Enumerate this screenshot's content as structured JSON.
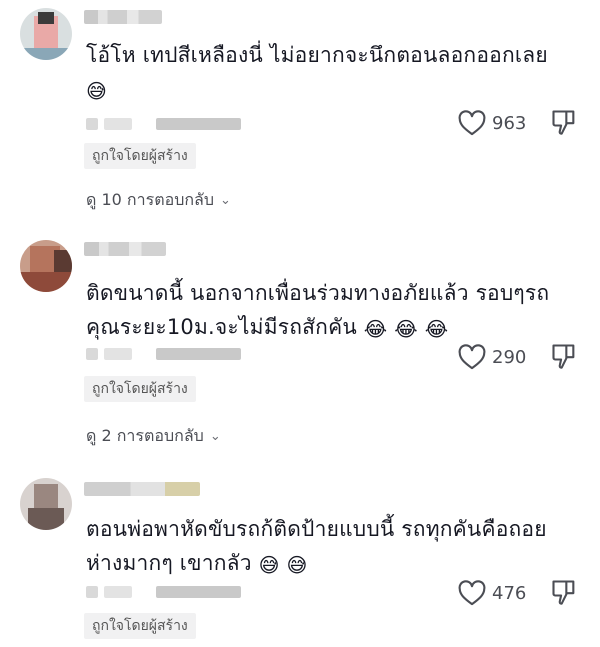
{
  "comments": [
    {
      "text": "โอ้โห เทปสีเหลืองนี่ ไม่อยากจะนึกตอนลอกออกเลย",
      "emojis": [
        "😅"
      ],
      "likes": "963",
      "creator_badge": "ถูกใจโดยผู้สร้าง",
      "replies_label": "ดู 10 การตอบกลับ",
      "replies_chevron": "⌄"
    },
    {
      "text": "ติดขนาดนี้ นอกจากเพื่อนร่วมทางอภัยแล้ว รอบๆรถคุณระยะ10ม.จะไม่มีรถสักคัน",
      "emojis": [
        "😂",
        "😂",
        "😂"
      ],
      "likes": "290",
      "creator_badge": "ถูกใจโดยผู้สร้าง",
      "replies_label": "ดู 2 การตอบกลับ",
      "replies_chevron": "⌄"
    },
    {
      "text": "ตอนพ่อพาหัดขับรถก้ติดป้ายแบบนี้ รถทุกคันคือถอยห่างมากๆ เขากลัว",
      "emojis": [
        "😅",
        "😅"
      ],
      "likes": "476",
      "creator_badge": "ถูกใจโดยผู้สร้าง"
    }
  ],
  "icons": {
    "like": "heart-outline-icon",
    "dislike": "thumbs-down-outline-icon"
  },
  "colors": {
    "text": "#161823",
    "muted": "#4b4d54",
    "badge_bg": "#f1f1f2"
  }
}
